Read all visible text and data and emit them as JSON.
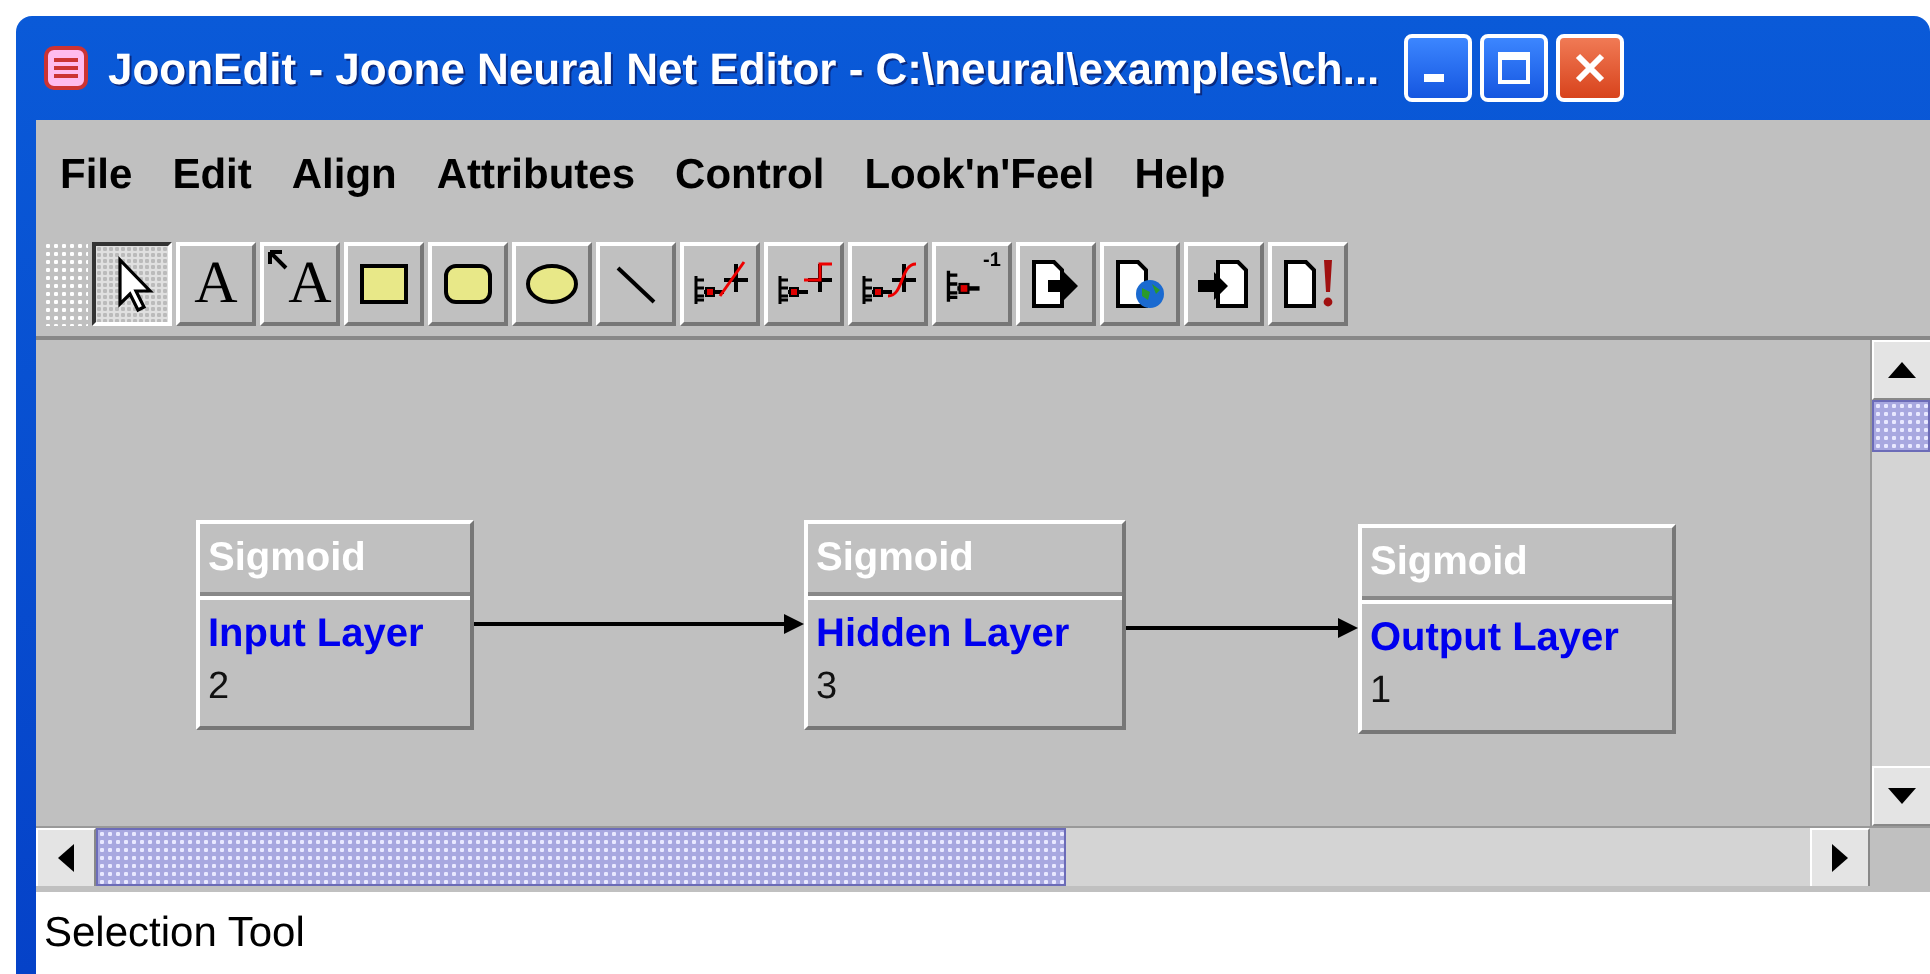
{
  "window": {
    "title": "JoonEdit - Joone Neural Net Editor - C:\\neural\\examples\\ch..."
  },
  "menu": [
    "File",
    "Edit",
    "Align",
    "Attributes",
    "Control",
    "Look'n'Feel",
    "Help"
  ],
  "toolbar": [
    {
      "kind": "pointer",
      "selected": true
    },
    {
      "kind": "text",
      "glyph": "A",
      "selected": false
    },
    {
      "kind": "text-arrow",
      "glyph": "A",
      "selected": false
    },
    {
      "kind": "rectangle",
      "selected": false
    },
    {
      "kind": "rounded-rectangle",
      "selected": false
    },
    {
      "kind": "ellipse",
      "selected": false
    },
    {
      "kind": "line",
      "selected": false
    },
    {
      "kind": "synapse-full",
      "selected": false
    },
    {
      "kind": "synapse-step",
      "selected": false
    },
    {
      "kind": "synapse-curve",
      "selected": false
    },
    {
      "kind": "synapse-delay",
      "glyph": "-1",
      "selected": false
    },
    {
      "kind": "export",
      "selected": false
    },
    {
      "kind": "export-globe",
      "selected": false
    },
    {
      "kind": "import",
      "selected": false
    },
    {
      "kind": "alert",
      "selected": false
    }
  ],
  "layers": [
    {
      "type": "Sigmoid",
      "name": "Input Layer",
      "size": "2"
    },
    {
      "type": "Sigmoid",
      "name": "Hidden Layer",
      "size": "3"
    },
    {
      "type": "Sigmoid",
      "name": "Output Layer",
      "size": "1"
    }
  ],
  "status_bar": "Selection Tool"
}
